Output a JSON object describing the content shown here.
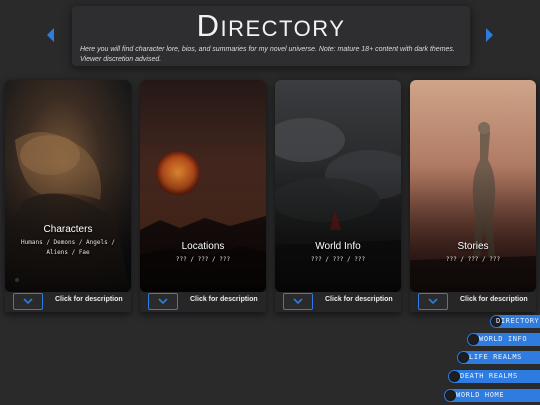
{
  "header": {
    "title": "Directory",
    "subtitle": "Here you will find character lore, bios, and summaries for my novel universe. Note: mature 18+ content with dark themes. Viewer discretion advised."
  },
  "cards": [
    {
      "title": "Characters",
      "subtitle": "Humans / Demons / Angels / Aliens / Fae",
      "footer": "Click for description"
    },
    {
      "title": "Locations",
      "subtitle": "??? / ??? / ???",
      "footer": "Click for description"
    },
    {
      "title": "World Info",
      "subtitle": "??? / ??? / ???",
      "footer": "Click for description"
    },
    {
      "title": "Stories",
      "subtitle": "??? / ??? / ???",
      "footer": "Click for description"
    }
  ],
  "nav": [
    {
      "label": "DIRECTORY"
    },
    {
      "label": "WORLD INFO"
    },
    {
      "label": "LIFE REALMS"
    },
    {
      "label": "DEATH REALMS"
    },
    {
      "label": "WORLD HOME"
    }
  ],
  "colors": {
    "accent": "#2f7ce0",
    "background": "#2a2a2b"
  }
}
